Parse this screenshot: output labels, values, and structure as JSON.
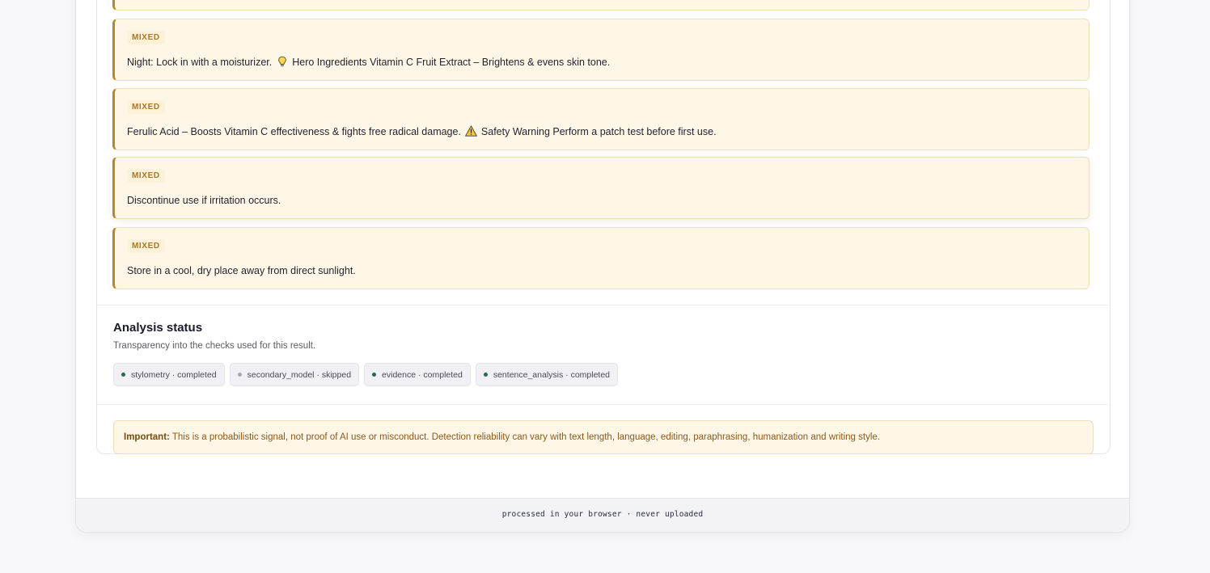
{
  "sentences": [
    {
      "label": "MIXED",
      "text": ""
    },
    {
      "label": "MIXED",
      "text_before": "Night: Lock in with a moisturizer.",
      "icon": "lightbulb-icon",
      "text_after": "Hero Ingredients Vitamin C Fruit Extract – Brightens & evens skin tone."
    },
    {
      "label": "MIXED",
      "text_before": "Ferulic Acid – Boosts Vitamin C effectiveness & fights free radical damage.",
      "icon": "warning-icon",
      "text_after": "Safety Warning Perform a patch test before first use."
    },
    {
      "label": "MIXED",
      "text": "Discontinue use if irritation occurs."
    },
    {
      "label": "MIXED",
      "text": "Store in a cool, dry place away from direct sunlight."
    }
  ],
  "analysis_status": {
    "title": "Analysis status",
    "subtitle": "Transparency into the checks used for this result.",
    "checks": [
      {
        "label": "stylometry · completed",
        "status": "completed",
        "color": "#1f6b4e"
      },
      {
        "label": "secondary_model · skipped",
        "status": "skipped",
        "color": "#a9a9b5"
      },
      {
        "label": "evidence · completed",
        "status": "completed",
        "color": "#1f6b4e"
      },
      {
        "label": "sentence_analysis · completed",
        "status": "completed",
        "color": "#1f6b4e"
      }
    ]
  },
  "notice": {
    "label": "Important:",
    "text": "This is a probabilistic signal, not proof of AI use or misconduct. Detection reliability can vary with text length, language, editing, paraphrasing, humanization and writing style."
  },
  "footer": {
    "text": "processed in your browser · never uploaded"
  },
  "colors": {
    "accent": "#b8862d",
    "mixed_bg": "#fef7e8",
    "completed": "#1f6b4e",
    "skipped": "#a9a9b5"
  }
}
